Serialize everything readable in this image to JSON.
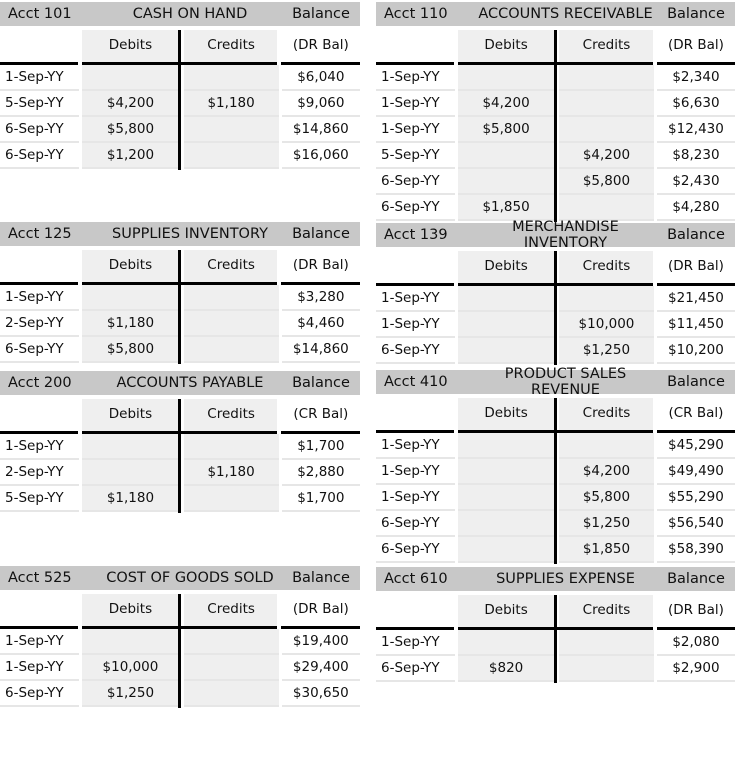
{
  "columns": {
    "debits": "Debits",
    "credits": "Credits"
  },
  "accounts": [
    {
      "number": "Acct 101",
      "name": "CASH ON HAND",
      "balance_label": "Balance",
      "balance_type": "(DR Bal)",
      "rows": [
        {
          "date": "1-Sep-YY",
          "debit": "",
          "credit": "",
          "balance": "$6,040"
        },
        {
          "date": "5-Sep-YY",
          "debit": "$4,200",
          "credit": "$1,180",
          "balance": "$9,060"
        },
        {
          "date": "6-Sep-YY",
          "debit": "$5,800",
          "credit": "",
          "balance": "$14,860"
        },
        {
          "date": "6-Sep-YY",
          "debit": "$1,200",
          "credit": "",
          "balance": "$16,060"
        }
      ]
    },
    {
      "number": "Acct 110",
      "name": "ACCOUNTS RECEIVABLE",
      "balance_label": "Balance",
      "balance_type": "(DR Bal)",
      "rows": [
        {
          "date": "1-Sep-YY",
          "debit": "",
          "credit": "",
          "balance": "$2,340"
        },
        {
          "date": "1-Sep-YY",
          "debit": "$4,200",
          "credit": "",
          "balance": "$6,630"
        },
        {
          "date": "1-Sep-YY",
          "debit": "$5,800",
          "credit": "",
          "balance": "$12,430"
        },
        {
          "date": "5-Sep-YY",
          "debit": "",
          "credit": "$4,200",
          "balance": "$8,230"
        },
        {
          "date": "6-Sep-YY",
          "debit": "",
          "credit": "$5,800",
          "balance": "$2,430"
        },
        {
          "date": "6-Sep-YY",
          "debit": "$1,850",
          "credit": "",
          "balance": "$4,280"
        }
      ]
    },
    {
      "number": "Acct 125",
      "name": "SUPPLIES INVENTORY",
      "balance_label": "Balance",
      "balance_type": "(DR Bal)",
      "rows": [
        {
          "date": "1-Sep-YY",
          "debit": "",
          "credit": "",
          "balance": "$3,280"
        },
        {
          "date": "2-Sep-YY",
          "debit": "$1,180",
          "credit": "",
          "balance": "$4,460"
        },
        {
          "date": "6-Sep-YY",
          "debit": "$5,800",
          "credit": "",
          "balance": "$14,860"
        }
      ]
    },
    {
      "number": "Acct 139",
      "name": "MERCHANDISE INVENTORY",
      "balance_label": "Balance",
      "balance_type": "(DR Bal)",
      "rows": [
        {
          "date": "1-Sep-YY",
          "debit": "",
          "credit": "",
          "balance": "$21,450"
        },
        {
          "date": "1-Sep-YY",
          "debit": "",
          "credit": "$10,000",
          "balance": "$11,450"
        },
        {
          "date": "6-Sep-YY",
          "debit": "",
          "credit": "$1,250",
          "balance": "$10,200"
        }
      ]
    },
    {
      "number": "Acct 200",
      "name": "ACCOUNTS PAYABLE",
      "balance_label": "Balance",
      "balance_type": "(CR Bal)",
      "rows": [
        {
          "date": "1-Sep-YY",
          "debit": "",
          "credit": "",
          "balance": "$1,700"
        },
        {
          "date": "2-Sep-YY",
          "debit": "",
          "credit": "$1,180",
          "balance": "$2,880"
        },
        {
          "date": "5-Sep-YY",
          "debit": "$1,180",
          "credit": "",
          "balance": "$1,700"
        }
      ]
    },
    {
      "number": "Acct 410",
      "name": "PRODUCT SALES REVENUE",
      "balance_label": "Balance",
      "balance_type": "(CR Bal)",
      "rows": [
        {
          "date": "1-Sep-YY",
          "debit": "",
          "credit": "",
          "balance": "$45,290"
        },
        {
          "date": "1-Sep-YY",
          "debit": "",
          "credit": "$4,200",
          "balance": "$49,490"
        },
        {
          "date": "1-Sep-YY",
          "debit": "",
          "credit": "$5,800",
          "balance": "$55,290"
        },
        {
          "date": "6-Sep-YY",
          "debit": "",
          "credit": "$1,250",
          "balance": "$56,540"
        },
        {
          "date": "6-Sep-YY",
          "debit": "",
          "credit": "$1,850",
          "balance": "$58,390"
        }
      ]
    },
    {
      "number": "Acct  525",
      "name": "COST OF GOODS SOLD",
      "balance_label": "Balance",
      "balance_type": "(DR Bal)",
      "rows": [
        {
          "date": "1-Sep-YY",
          "debit": "",
          "credit": "",
          "balance": "$19,400"
        },
        {
          "date": "1-Sep-YY",
          "debit": "$10,000",
          "credit": "",
          "balance": "$29,400"
        },
        {
          "date": "6-Sep-YY",
          "debit": "$1,250",
          "credit": "",
          "balance": "$30,650"
        }
      ]
    },
    {
      "number": "Acct  610",
      "name": "SUPPLIES EXPENSE",
      "balance_label": "Balance",
      "balance_type": "(DR Bal)",
      "rows": [
        {
          "date": "1-Sep-YY",
          "debit": "",
          "credit": "",
          "balance": "$2,080"
        },
        {
          "date": "6-Sep-YY",
          "debit": "$820",
          "credit": "",
          "balance": "$2,900"
        }
      ]
    }
  ]
}
